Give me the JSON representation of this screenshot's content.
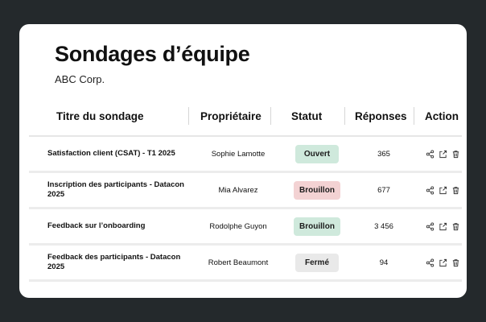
{
  "page": {
    "title": "Sondages d’équipe",
    "subtitle": "ABC Corp."
  },
  "table": {
    "columns": [
      "Titre du sondage",
      "Propriétaire",
      "Statut",
      "Réponses",
      "Action"
    ],
    "rows": [
      {
        "title": "Satisfaction client (CSAT) - T1 2025",
        "owner": "Sophie Lamotte",
        "status": "Ouvert",
        "status_color": "#cfe9dc",
        "responses": "365"
      },
      {
        "title": "Inscription des participants - Datacon 2025",
        "owner": "Mia Alvarez",
        "status": "Brouillon",
        "status_color": "#f3d2d3",
        "responses": "677"
      },
      {
        "title": "Feedback sur l’onboarding",
        "owner": "Rodolphe Guyon",
        "status": "Brouillon",
        "status_color": "#cfe9dc",
        "responses": "3 456"
      },
      {
        "title": "Feedback des participants - Datacon 2025",
        "owner": "Robert Beaumont",
        "status": "Fermé",
        "status_color": "#e9e9e9",
        "responses": "94"
      }
    ],
    "action_icons": [
      "share-icon",
      "export-icon",
      "trash-icon"
    ]
  }
}
